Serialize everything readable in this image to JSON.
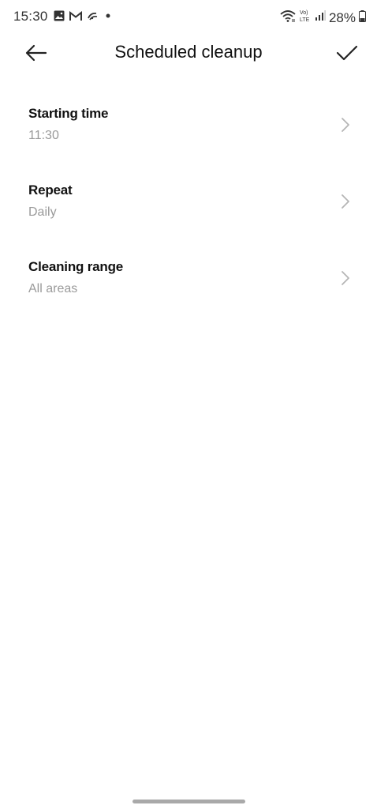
{
  "status_bar": {
    "time": "15:30",
    "network_label": "Vo)) LTE",
    "battery": "28%"
  },
  "app_bar": {
    "title": "Scheduled cleanup"
  },
  "settings": [
    {
      "title": "Starting time",
      "value": "11:30"
    },
    {
      "title": "Repeat",
      "value": "Daily"
    },
    {
      "title": "Cleaning range",
      "value": "All areas"
    }
  ]
}
